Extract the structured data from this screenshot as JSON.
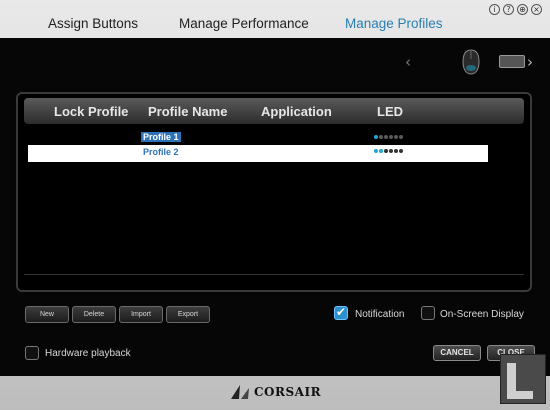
{
  "tabs": [
    {
      "label": "Assign Buttons"
    },
    {
      "label": "Manage Performance"
    },
    {
      "label": "Manage Profiles",
      "active": true
    }
  ],
  "window_icons": [
    "info-icon",
    "help-icon",
    "globe-icon",
    "close-icon"
  ],
  "device_strip": {
    "prev_icon": "chevron-left-icon",
    "next_icon": "chevron-right-icon",
    "devices": [
      "mouse-icon",
      "keyboard-icon"
    ]
  },
  "table": {
    "columns": [
      "Lock Profile",
      "Profile Name",
      "Application",
      "LED"
    ],
    "rows": [
      {
        "name": "Profile 1",
        "selected": true,
        "led_level": 1,
        "led_total": 6
      },
      {
        "name": "Profile 2",
        "selected": false,
        "led_level": 2,
        "led_total": 6
      }
    ]
  },
  "actions": {
    "new": "New",
    "delete": "Delete",
    "import": "Import",
    "export": "Export"
  },
  "options": {
    "notification": {
      "label": "Notification",
      "checked": true
    },
    "osd": {
      "label": "On-Screen Display",
      "checked": false
    },
    "hardware_playback": {
      "label": "Hardware playback",
      "checked": false
    }
  },
  "buttons": {
    "cancel": "CANCEL",
    "close": "CLOSE"
  },
  "brand": {
    "name": "CORSAIR"
  },
  "colors": {
    "accent": "#2d72b8",
    "led_on": "#1ca9d4",
    "panel": "#060606"
  }
}
